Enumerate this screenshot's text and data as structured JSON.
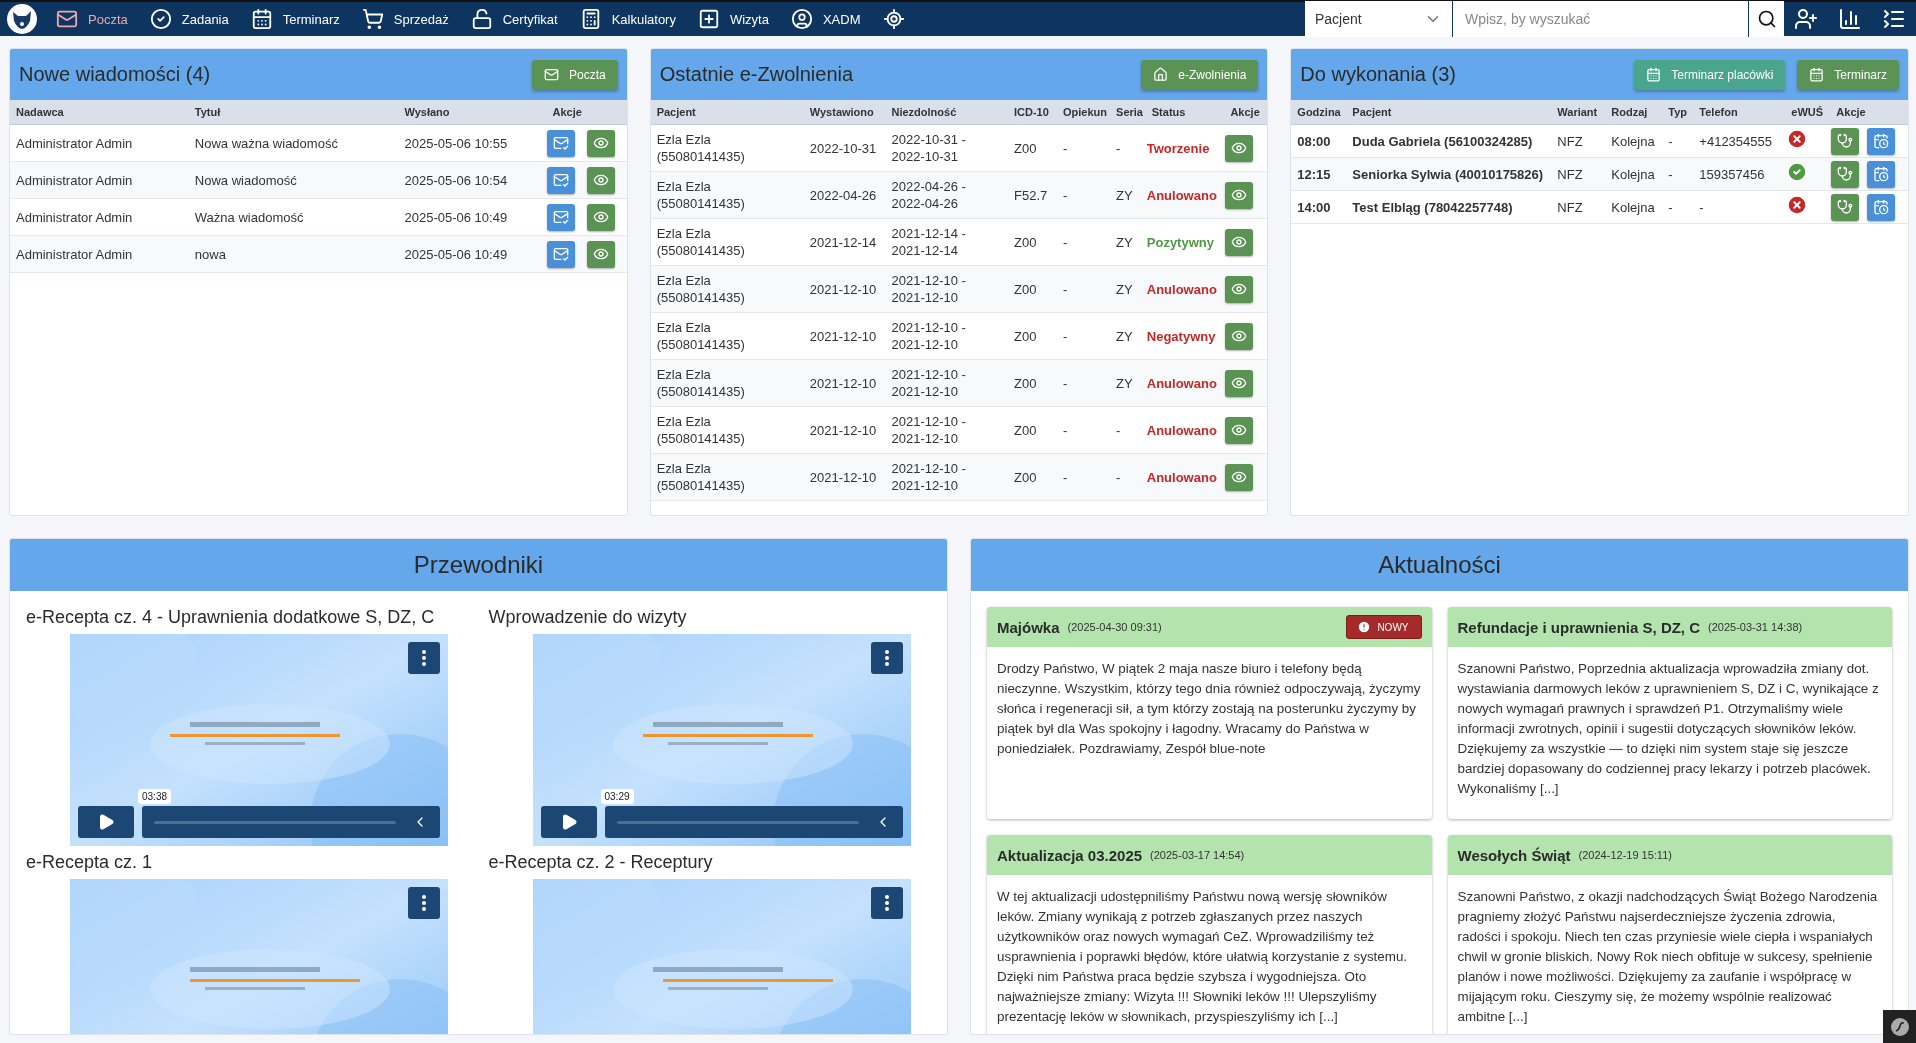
{
  "nav": [
    {
      "kind": "mail",
      "label": "Poczta",
      "selected": true
    },
    {
      "kind": "tasks",
      "label": "Zadania",
      "selected": false
    },
    {
      "kind": "calendar",
      "label": "Terminarz",
      "selected": false
    },
    {
      "kind": "cart",
      "label": "Sprzedaż",
      "selected": false
    },
    {
      "kind": "lock",
      "label": "Certyfikat",
      "selected": false
    },
    {
      "kind": "calculator",
      "label": "Kalkulatory",
      "selected": false
    },
    {
      "kind": "plus",
      "label": "Wizyta",
      "selected": false
    },
    {
      "kind": "user",
      "label": "XADM",
      "selected": false
    },
    {
      "kind": "target",
      "selected": false
    }
  ],
  "search": {
    "scope": "Pacjent",
    "placeholder": "Wpisz, by wyszukać"
  },
  "messages": {
    "title": "Nowe wiadomości (4)",
    "button": "Poczta",
    "columns": [
      "Nadawca",
      "Tytuł",
      "Wysłano",
      "Akcje"
    ],
    "rows": [
      {
        "sender": "Administrator Admin",
        "subject": "Nowa ważna wiadomość",
        "sent": "2025-05-06 10:55"
      },
      {
        "sender": "Administrator Admin",
        "subject": "Nowa wiadomość",
        "sent": "2025-05-06 10:54"
      },
      {
        "sender": "Administrator Admin",
        "subject": "Ważna wiadomość",
        "sent": "2025-05-06 10:49"
      },
      {
        "sender": "Administrator Admin",
        "subject": "nowa",
        "sent": "2025-05-06 10:49"
      }
    ]
  },
  "leaves": {
    "title": "Ostatnie e-Zwolnienia",
    "button": "e-Zwolnienia",
    "columns": [
      "Pacjent",
      "Wystawiono",
      "Niezdolność",
      "ICD-10",
      "Opiekun",
      "Seria",
      "Status",
      "Akcje"
    ],
    "rows": [
      {
        "patient": "Ezla Ezla (55080141435)",
        "issued": "2022-10-31",
        "period": "2022-10-31 - 2022-10-31",
        "icd": "Z00",
        "guardian": "-",
        "series": "-",
        "status": "Tworzenie",
        "color": "#c62828"
      },
      {
        "patient": "Ezla Ezla (55080141435)",
        "issued": "2022-04-26",
        "period": "2022-04-26 - 2022-04-26",
        "icd": "F52.7",
        "guardian": "-",
        "series": "ZY",
        "status": "Anulowano",
        "color": "#c62828"
      },
      {
        "patient": "Ezla Ezla (55080141435)",
        "issued": "2021-12-14",
        "period": "2021-12-14 - 2021-12-14",
        "icd": "Z00",
        "guardian": "-",
        "series": "ZY",
        "status": "Pozytywny",
        "color": "#4f9a45"
      },
      {
        "patient": "Ezla Ezla (55080141435)",
        "issued": "2021-12-10",
        "period": "2021-12-10 - 2021-12-10",
        "icd": "Z00",
        "guardian": "-",
        "series": "ZY",
        "status": "Anulowano",
        "color": "#c62828"
      },
      {
        "patient": "Ezla Ezla (55080141435)",
        "issued": "2021-12-10",
        "period": "2021-12-10 - 2021-12-10",
        "icd": "Z00",
        "guardian": "-",
        "series": "ZY",
        "status": "Negatywny",
        "color": "#c62828"
      },
      {
        "patient": "Ezla Ezla (55080141435)",
        "issued": "2021-12-10",
        "period": "2021-12-10 - 2021-12-10",
        "icd": "Z00",
        "guardian": "-",
        "series": "ZY",
        "status": "Anulowano",
        "color": "#c62828"
      },
      {
        "patient": "Ezla Ezla (55080141435)",
        "issued": "2021-12-10",
        "period": "2021-12-10 - 2021-12-10",
        "icd": "Z00",
        "guardian": "-",
        "series": "-",
        "status": "Anulowano",
        "color": "#c62828"
      },
      {
        "patient": "Ezla Ezla (55080141435)",
        "issued": "2021-12-10",
        "period": "2021-12-10 - 2021-12-10",
        "icd": "Z00",
        "guardian": "-",
        "series": "-",
        "status": "Anulowano",
        "color": "#c62828"
      }
    ]
  },
  "todo": {
    "title": "Do wykonania (3)",
    "buttons": [
      {
        "label": "Terminarz placówki",
        "kind": "teal"
      },
      {
        "label": "Terminarz",
        "kind": "green"
      }
    ],
    "columns": [
      "Godzina",
      "Pacjent",
      "Wariant",
      "Rodzaj",
      "Typ",
      "Telefon",
      "eWUŚ",
      "Akcje"
    ],
    "rows": [
      {
        "time": "08:00",
        "patient": "Duda Gabriela (56100324285)",
        "variant": "NFZ",
        "type": "Kolejna",
        "kind": "-",
        "phone": "+412354555",
        "ewus_valid": false
      },
      {
        "time": "12:15",
        "patient": "Seniorka Sylwia (40010175826)",
        "variant": "NFZ",
        "type": "Kolejna",
        "kind": "-",
        "phone": "159357456",
        "ewus_valid": true
      },
      {
        "time": "14:00",
        "patient": "Test Elbląg (78042257748)",
        "variant": "NFZ",
        "type": "Kolejna",
        "kind": "-",
        "phone": "-",
        "ewus_valid": false
      }
    ]
  },
  "guides": {
    "title": "Przewodniki",
    "videos": [
      {
        "title": "e-Recepta cz. 4 - Uprawnienia dodatkowe S, DZ, C",
        "controls": true,
        "duration": "03:38"
      },
      {
        "title": "Wprowadzenie do wizyty",
        "controls": true,
        "duration": "03:29"
      },
      {
        "title": "e-Recepta cz. 1",
        "controls": false
      },
      {
        "title": "e-Recepta cz. 2 - Receptury",
        "controls": false
      }
    ]
  },
  "news": {
    "title": "Aktualności",
    "items": [
      {
        "title": "Majówka",
        "date": "(2025-04-30 09:31)",
        "badge": "NOWY",
        "body": "Drodzy Państwo, W piątek 2 maja nasze biuro i telefony będą nieczynne. Wszystkim, którzy tego dnia również odpoczywają, życzymy słońca i regeneracji sił, a tym którzy zostają na posterunku życzymy by piątek był dla Was spokojny i łagodny. Wracamy do Państwa w poniedziałek. Pozdrawiamy, Zespół blue-note"
      },
      {
        "title": "Refundacje i uprawnienia S, DZ, C",
        "date": "(2025-03-31 14:38)",
        "body": "Szanowni Państwo, Poprzednia aktualizacja wprowadziła zmiany dot. wystawiania darmowych leków z uprawnieniem S, DZ i C, wynikające z nowych wymagań prawnych i sprawdzeń P1. Otrzymaliśmy wiele informacji zwrotnych, opinii i sugestii dotyczących słowników leków. Dziękujemy za wszystkie — to dzięki nim system staje się jeszcze bardziej dopasowany do codziennej pracy lekarzy i potrzeb placówek. Wykonaliśmy [...]"
      },
      {
        "title": "Aktualizacja 03.2025",
        "date": "(2025-03-17 14:54)",
        "body": "W tej aktualizacji udostępniliśmy Państwu nową wersję słowników leków. Zmiany wynikają z potrzeb zgłaszanych przez naszych użytkowników oraz nowych wymagań CeZ. Wprowadziliśmy też usprawnienia i poprawki błędów, które ułatwią korzystanie z systemu. Dzięki nim Państwa praca będzie szybsza i wygodniejsza. Oto najważniejsze zmiany: Wizyta !!! Słowniki leków !!! Ulepszyliśmy prezentację leków w słownikach, przyspieszyliśmy ich [...]"
      },
      {
        "title": "Wesołych Świąt",
        "date": "(2024-12-19 15:11)",
        "body": "Szanowni Państwo, z okazji nadchodzących Świąt Bożego Narodzenia pragniemy złożyć Państwu najserdeczniejsze życzenia zdrowia, radości i spokoju. Niech ten czas przyniesie wiele ciepła i wspaniałych chwil w gronie bliskich. Nowy Rok niech obfituje w sukcesy, spełnienie planów i nowe możliwości. Dziękujemy za zaufanie i współpracę w mijającym roku. Cieszymy się, że możemy wspólnie realizować ambitne [...]"
      }
    ]
  }
}
